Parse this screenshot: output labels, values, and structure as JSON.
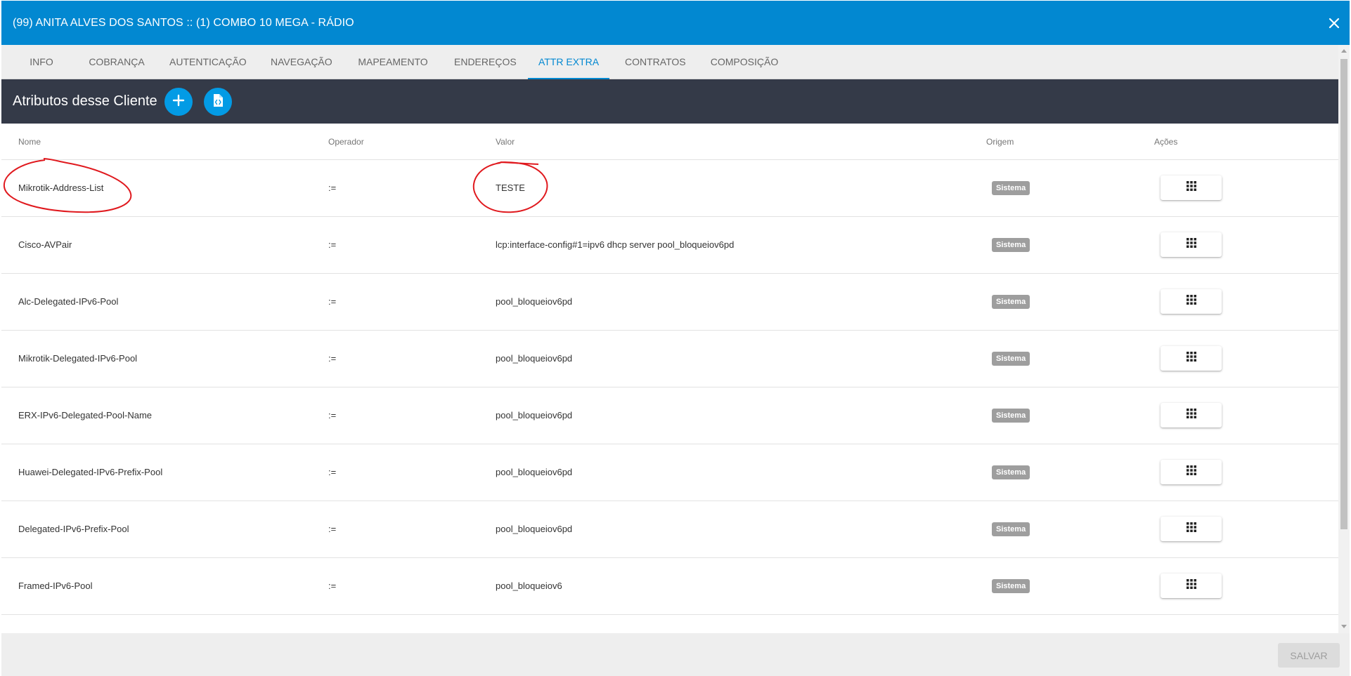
{
  "window": {
    "title": "(99) ANITA ALVES DOS SANTOS :: (1) COMBO 10 MEGA - RÁDIO",
    "close_icon": "close-icon"
  },
  "tabs": [
    {
      "label": "INFO",
      "active": false
    },
    {
      "label": "COBRANÇA",
      "active": false
    },
    {
      "label": "AUTENTICAÇÃO",
      "active": false
    },
    {
      "label": "NAVEGAÇÃO",
      "active": false
    },
    {
      "label": "MAPEAMENTO",
      "active": false
    },
    {
      "label": "ENDEREÇOS",
      "active": false
    },
    {
      "label": "ATTR EXTRA",
      "active": true
    },
    {
      "label": "CONTRATOS",
      "active": false
    },
    {
      "label": "COMPOSIÇÃO",
      "active": false
    }
  ],
  "toolbar": {
    "heading": "Atributos desse Cliente",
    "add_icon": "plus-icon",
    "export_icon": "code-file-icon"
  },
  "table": {
    "headers": {
      "nome": "Nome",
      "operador": "Operador",
      "valor": "Valor",
      "origem": "Origem",
      "acoes": "Ações"
    },
    "rows": [
      {
        "nome": "Mikrotik-Address-List",
        "operador": ":=",
        "valor": "TESTE",
        "origem": "Sistema"
      },
      {
        "nome": "Cisco-AVPair",
        "operador": ":=",
        "valor": "lcp:interface-config#1=ipv6 dhcp server pool_bloqueiov6pd",
        "origem": "Sistema"
      },
      {
        "nome": "Alc-Delegated-IPv6-Pool",
        "operador": ":=",
        "valor": "pool_bloqueiov6pd",
        "origem": "Sistema"
      },
      {
        "nome": "Mikrotik-Delegated-IPv6-Pool",
        "operador": ":=",
        "valor": "pool_bloqueiov6pd",
        "origem": "Sistema"
      },
      {
        "nome": "ERX-IPv6-Delegated-Pool-Name",
        "operador": ":=",
        "valor": "pool_bloqueiov6pd",
        "origem": "Sistema"
      },
      {
        "nome": "Huawei-Delegated-IPv6-Prefix-Pool",
        "operador": ":=",
        "valor": "pool_bloqueiov6pd",
        "origem": "Sistema"
      },
      {
        "nome": "Delegated-IPv6-Prefix-Pool",
        "operador": ":=",
        "valor": "pool_bloqueiov6pd",
        "origem": "Sistema"
      },
      {
        "nome": "Framed-IPv6-Pool",
        "operador": ":=",
        "valor": "pool_bloqueiov6",
        "origem": "Sistema"
      }
    ],
    "action_icon": "grid-menu-icon"
  },
  "footer": {
    "save_label": "SALVAR"
  },
  "colors": {
    "primary": "#0288d1",
    "fab": "#039be5",
    "toolbar_bg": "#343a48",
    "badge_bg": "#9e9e9e",
    "annotation": "#e0191e"
  }
}
